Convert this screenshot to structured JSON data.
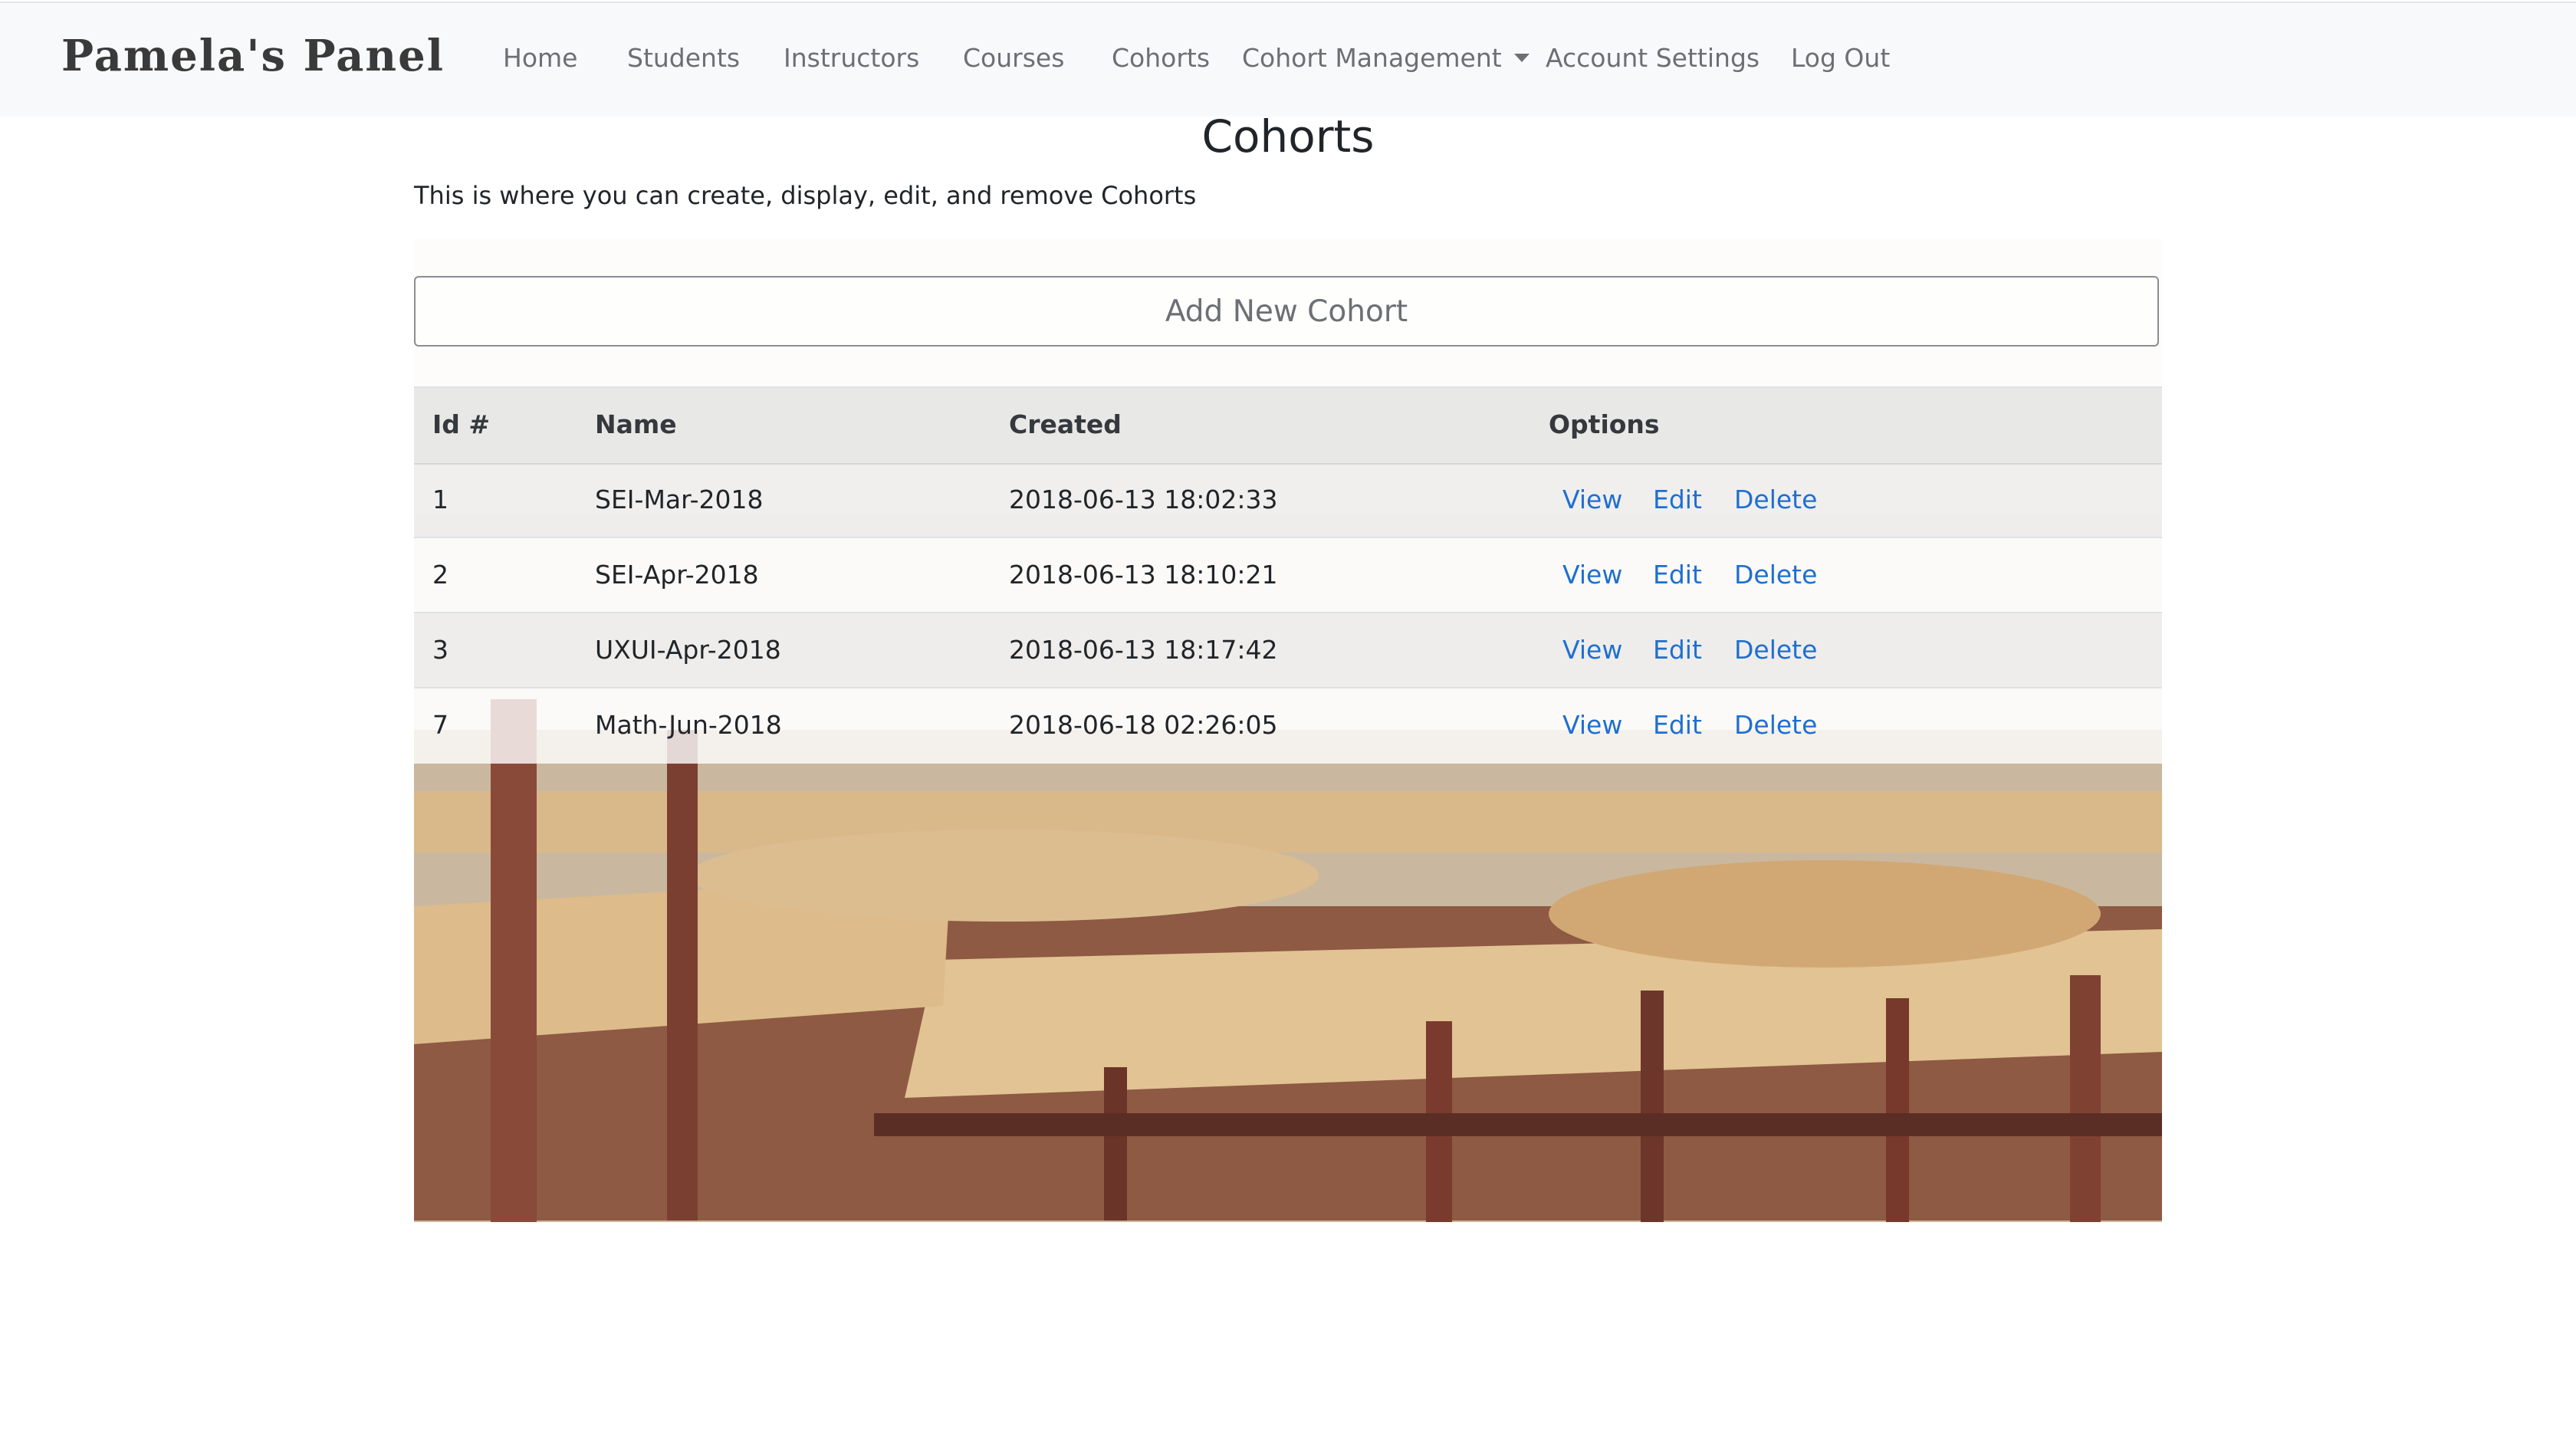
{
  "nav": {
    "brand": "Pamela's Panel",
    "links": [
      "Home",
      "Students",
      "Instructors",
      "Courses",
      "Cohorts"
    ],
    "dropdown_label": "Cohort Management",
    "account_settings": "Account Settings",
    "logout": "Log Out"
  },
  "page": {
    "title": "Cohorts",
    "intro": "This is where you can create, display, edit, and remove Cohorts"
  },
  "panel": {
    "add_button": "Add New Cohort",
    "columns": [
      "Id #",
      "Name",
      "Created",
      "Options"
    ],
    "rows": [
      {
        "id": "1",
        "name": "SEI-Mar-2018",
        "created": "2018-06-13 18:02:33"
      },
      {
        "id": "2",
        "name": "SEI-Apr-2018",
        "created": "2018-06-13 18:10:21"
      },
      {
        "id": "3",
        "name": "UXUI-Apr-2018",
        "created": "2018-06-13 18:17:42"
      },
      {
        "id": "7",
        "name": "Math-Jun-2018",
        "created": "2018-06-18 02:26:05"
      }
    ],
    "actions": {
      "view": "View",
      "edit": "Edit",
      "delete": "Delete"
    }
  },
  "colors": {
    "link": "#1f6fd0",
    "navbar_bg": "#f8f9fa",
    "nav_text": "#6c6f73"
  }
}
